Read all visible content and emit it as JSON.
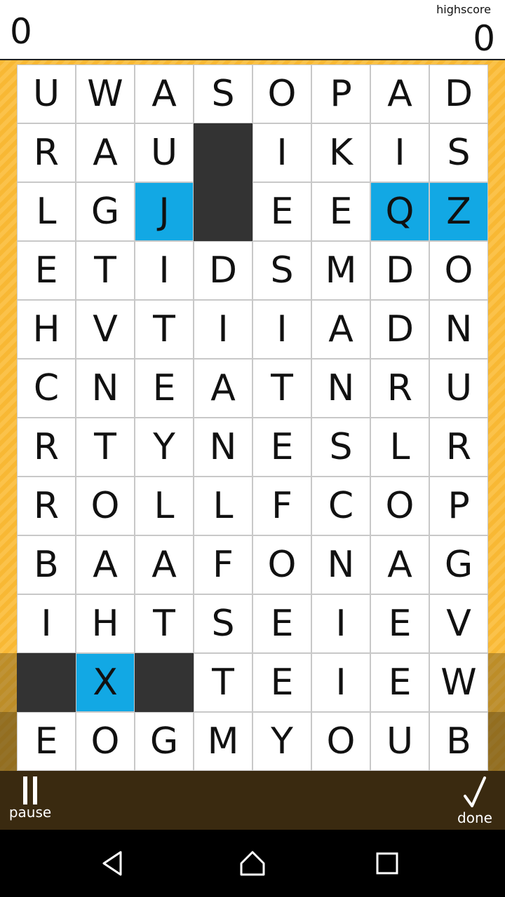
{
  "header": {
    "score": "0",
    "highscore_label": "highscore",
    "highscore": "0"
  },
  "board": {
    "rows": [
      [
        {
          "t": "U"
        },
        {
          "t": "W"
        },
        {
          "t": "A"
        },
        {
          "t": "S"
        },
        {
          "t": "O"
        },
        {
          "t": "P"
        },
        {
          "t": "A"
        },
        {
          "t": "D"
        }
      ],
      [
        {
          "t": "R"
        },
        {
          "t": "A"
        },
        {
          "t": "U"
        },
        {
          "t": "",
          "s": "block"
        },
        {
          "t": "I"
        },
        {
          "t": "K"
        },
        {
          "t": "I"
        },
        {
          "t": "S"
        }
      ],
      [
        {
          "t": "L"
        },
        {
          "t": "G"
        },
        {
          "t": "J",
          "s": "selected"
        },
        {
          "t": "",
          "s": "block"
        },
        {
          "t": "E"
        },
        {
          "t": "E"
        },
        {
          "t": "Q",
          "s": "selected"
        },
        {
          "t": "Z",
          "s": "selected"
        }
      ],
      [
        {
          "t": "E"
        },
        {
          "t": "T"
        },
        {
          "t": "I"
        },
        {
          "t": "D"
        },
        {
          "t": "S"
        },
        {
          "t": "M"
        },
        {
          "t": "D"
        },
        {
          "t": "O"
        }
      ],
      [
        {
          "t": "H"
        },
        {
          "t": "V"
        },
        {
          "t": "T"
        },
        {
          "t": "I"
        },
        {
          "t": "I"
        },
        {
          "t": "A"
        },
        {
          "t": "D"
        },
        {
          "t": "N"
        }
      ],
      [
        {
          "t": "C"
        },
        {
          "t": "N"
        },
        {
          "t": "E"
        },
        {
          "t": "A"
        },
        {
          "t": "T"
        },
        {
          "t": "N"
        },
        {
          "t": "R"
        },
        {
          "t": "U"
        }
      ],
      [
        {
          "t": "R"
        },
        {
          "t": "T"
        },
        {
          "t": "Y"
        },
        {
          "t": "N"
        },
        {
          "t": "E"
        },
        {
          "t": "S"
        },
        {
          "t": "L"
        },
        {
          "t": "R"
        }
      ],
      [
        {
          "t": "R"
        },
        {
          "t": "O"
        },
        {
          "t": "L"
        },
        {
          "t": "L"
        },
        {
          "t": "F"
        },
        {
          "t": "C"
        },
        {
          "t": "O"
        },
        {
          "t": "P"
        }
      ],
      [
        {
          "t": "B"
        },
        {
          "t": "A"
        },
        {
          "t": "A"
        },
        {
          "t": "F"
        },
        {
          "t": "O"
        },
        {
          "t": "N"
        },
        {
          "t": "A"
        },
        {
          "t": "G"
        }
      ],
      [
        {
          "t": "I"
        },
        {
          "t": "H"
        },
        {
          "t": "T"
        },
        {
          "t": "S"
        },
        {
          "t": "E"
        },
        {
          "t": "I"
        },
        {
          "t": "E"
        },
        {
          "t": "V"
        }
      ],
      [
        {
          "t": "",
          "s": "block"
        },
        {
          "t": "X",
          "s": "selected"
        },
        {
          "t": "",
          "s": "block"
        },
        {
          "t": "T"
        },
        {
          "t": "E"
        },
        {
          "t": "I"
        },
        {
          "t": "E"
        },
        {
          "t": "W"
        }
      ],
      [
        {
          "t": "E"
        },
        {
          "t": "O"
        },
        {
          "t": "G"
        },
        {
          "t": "M"
        },
        {
          "t": "Y"
        },
        {
          "t": "O"
        },
        {
          "t": "U"
        },
        {
          "t": "B"
        }
      ]
    ]
  },
  "footer": {
    "pause_label": "pause",
    "done_label": "done",
    "pause_icon": "pause-icon",
    "done_icon": "checkmark-icon"
  },
  "navbar": {
    "back_icon": "back-triangle-icon",
    "home_icon": "home-icon",
    "recent_icon": "recent-apps-icon"
  },
  "colors": {
    "selected": "#12a8e4",
    "block": "#333333",
    "background": "#f8b834",
    "footer": "#3a2a10"
  }
}
